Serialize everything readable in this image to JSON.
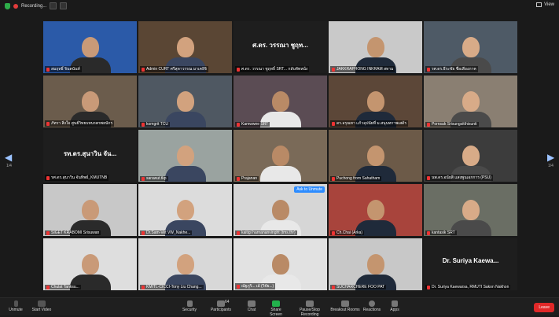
{
  "topbar": {
    "recording_label": "Recording...",
    "view_label": "View"
  },
  "tiles": [
    {
      "name": "สมฤทธิ์ จินตนันท์",
      "bigtext": "",
      "bg": "#2b5aa8",
      "badge": ""
    },
    {
      "name": "Admin CURT ศรีสุดาวรรณ มาเคอิจิ",
      "bigtext": "",
      "bg": "#5a4634",
      "badge": ""
    },
    {
      "name": "ศ.ดร. วรรณา ชูฤทธิ์ SRT... กลับทัพหน้ง",
      "bigtext": "ศ.ดร. วรรณา ชูฤท...",
      "bg": "#1e1e1e",
      "badge": ""
    },
    {
      "name": "JAKKRAPHONG INKRAM สทาม",
      "bigtext": "",
      "bg": "#c9c9c9",
      "badge": ""
    },
    {
      "name": "รศ.ดร.ธีระชัย ชื่อเสียงภาค",
      "bigtext": "",
      "bg": "#4e5a66",
      "badge": ""
    },
    {
      "name": "ภัทรา สิ่งใจ ศูนย์วิทยบทนรตรพยนักร",
      "bigtext": "",
      "bg": "#6b5c4c",
      "badge": ""
    },
    {
      "name": "komgrit TCU",
      "bigtext": "",
      "bg": "#4f5862",
      "badge": ""
    },
    {
      "name": "Kamwwee SRT",
      "bigtext": "",
      "bg": "#5b4c54",
      "badge": ""
    },
    {
      "name": "ดร.อรุณทา แก้วอุปนัยที่ ม.สนุนทกาพเสด้ร",
      "bigtext": "",
      "bg": "#5c4738",
      "badge": ""
    },
    {
      "name": "Pornsak Srisungsitthisunti",
      "bigtext": "",
      "bg": "#8a7f72",
      "badge": ""
    },
    {
      "name": "รศ.ดร.สุนาวิน จันทิพย์_KMUTNB",
      "bigtext": "รท.ดร.สุนาวิน จัน...",
      "bg": "#1e1e1e",
      "badge": ""
    },
    {
      "name": "sarawut.tkp",
      "bigtext": "",
      "bg": "#9aa3a0",
      "badge": ""
    },
    {
      "name": "Prajanan",
      "bigtext": "",
      "bg": "#7a6a58",
      "badge": ""
    },
    {
      "name": "Puchong from Sahatham",
      "bigtext": "",
      "bg": "#6c5a48",
      "badge": ""
    },
    {
      "name": "นพ.ดร.อนัยสิ แสงพูนเอกการ (PSU)",
      "bigtext": "",
      "bg": "#3c3c3c",
      "badge": ""
    },
    {
      "name": "SIGET KRABOMI Srisuwan",
      "bigtext": "",
      "bg": "#c8c8c8",
      "badge": ""
    },
    {
      "name": "Dr.Sam-Vet VW_Nakhe...",
      "bigtext": "",
      "bg": "#dcdcdc",
      "badge": ""
    },
    {
      "name": "kaitigi harnananvinght (tms.thr)",
      "bigtext": "",
      "bg": "#d6d6d6",
      "badge": "Ask to Unmute"
    },
    {
      "name": "Ch.Chai (Arka)",
      "bigtext": "",
      "bg": "#a8443c",
      "badge": ""
    },
    {
      "name": "kantasik SRT",
      "bigtext": "",
      "bg": "#6a6e64",
      "badge": ""
    },
    {
      "name": "Chulat Tanksu...",
      "bigtext": "",
      "bg": "#dedede",
      "badge": ""
    },
    {
      "name": "KMITL-CICCI-Tony Liu Chang...",
      "bigtext": "",
      "bg": "#d8d8d8",
      "badge": ""
    },
    {
      "name": "ณัฐภูริ... เอ้ (วิจัย...)",
      "bigtext": "",
      "bg": "#e2e2e2",
      "badge": ""
    },
    {
      "name": "SUCHARCHERE FOO PAT",
      "bigtext": "",
      "bg": "#c8c8c8",
      "badge": ""
    },
    {
      "name": "Dr. Suriya Kaewarsa, RMUTI Sakon Nakhon",
      "bigtext": "Dr. Suriya Kaewa...",
      "bg": "#1e1e1e",
      "badge": ""
    }
  ],
  "nav": {
    "left_page": "1/4",
    "right_page": "1/4"
  },
  "toolbar": {
    "unmute": "Unmute",
    "start_video": "Start Video",
    "security": "Security",
    "participants": "Participants",
    "participants_count": "64",
    "chat": "Chat",
    "share_screen": "Share Screen",
    "pause_stop": "Pause/Stop Recording",
    "breakout": "Breakout Rooms",
    "reactions": "Reactions",
    "apps": "Apps",
    "leave": "Leave"
  },
  "colors": {
    "accent": "#2d8cff",
    "share": "#22b14c",
    "leave": "#e02828",
    "record": "#e23b3b"
  }
}
